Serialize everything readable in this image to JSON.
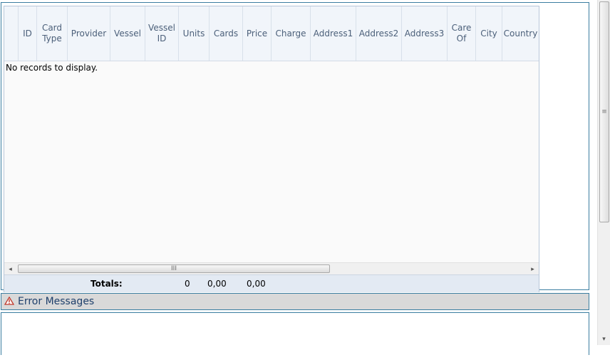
{
  "grid": {
    "columns": [
      "",
      "ID",
      "Card Type",
      "Provider",
      "Vessel",
      "Vessel ID",
      "Units",
      "Cards",
      "Price",
      "Charge",
      "Address1",
      "Address2",
      "Address3",
      "Care Of",
      "City",
      "Country"
    ],
    "empty_message": "No records to display.",
    "totals": {
      "label": "Totals:",
      "units": "0",
      "cards": "0,00",
      "price": "0,00"
    }
  },
  "error_panel": {
    "title": "Error Messages"
  },
  "icons": {
    "scroll_left": "◂",
    "scroll_right": "▸",
    "scroll_down": "▾",
    "grip_h": "III",
    "grip_v": "≡",
    "warning": "warning-icon"
  }
}
